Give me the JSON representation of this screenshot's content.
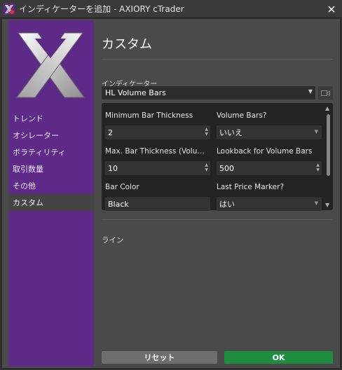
{
  "window": {
    "title": "インディケーターを追加 - AXIORY cTrader",
    "close_glyph": "✕"
  },
  "sidebar": {
    "items": [
      {
        "label": "トレンド"
      },
      {
        "label": "オシレーター"
      },
      {
        "label": "ボラティリティ"
      },
      {
        "label": "取引数量"
      },
      {
        "label": "その他"
      },
      {
        "label": "カスタム",
        "active": true
      }
    ]
  },
  "main": {
    "title": "カスタム",
    "indicator_label": "インディケーター",
    "indicator_value": "HL Volume Bars",
    "params": [
      {
        "label": "Minimum Bar Thickness",
        "value": "2",
        "kind": "spin"
      },
      {
        "label": "Volume Bars?",
        "value": "いいえ",
        "kind": "dropdown"
      },
      {
        "label": "Max. Bar Thickness (Volume Bars)",
        "value": "10",
        "kind": "spin"
      },
      {
        "label": "Lookback for Volume Bars",
        "value": "500",
        "kind": "spin"
      },
      {
        "label": "Bar Color",
        "value": "Black",
        "kind": "text"
      },
      {
        "label": "Last Price Marker?",
        "value": "はい",
        "kind": "dropdown"
      }
    ],
    "line_label": "ライン"
  },
  "buttons": {
    "reset": "リセット",
    "ok": "OK"
  },
  "colors": {
    "sidebar": "#5e2a87",
    "ok": "#1e8e3e",
    "reset": "#6e6e6e"
  }
}
